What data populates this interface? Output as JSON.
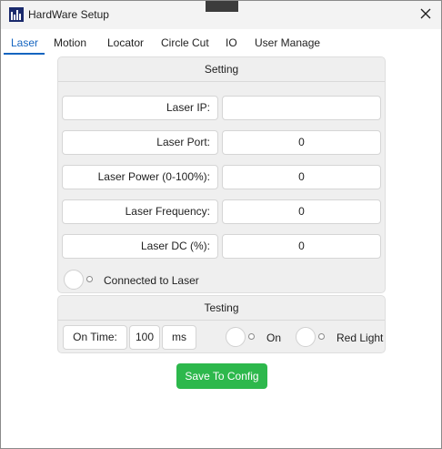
{
  "window": {
    "title": "HardWare Setup",
    "app_icon": "hardware-setup-icon",
    "close_icon": "close-icon"
  },
  "tabs": [
    {
      "label": "Laser",
      "active": true
    },
    {
      "label": "Motion",
      "active": false
    },
    {
      "label": "Locator",
      "active": false
    },
    {
      "label": "Circle Cut",
      "active": false
    },
    {
      "label": "IO",
      "active": false
    },
    {
      "label": "User Manage",
      "active": false
    }
  ],
  "setting": {
    "header": "Setting",
    "fields": [
      {
        "label": "Laser IP:",
        "value": ""
      },
      {
        "label": "Laser Port:",
        "value": "0"
      },
      {
        "label": "Laser Power (0-100%):",
        "value": "0"
      },
      {
        "label": "Laser Frequency:",
        "value": "0"
      },
      {
        "label": "Laser DC (%):",
        "value": "0"
      }
    ],
    "connected_toggle": {
      "label": "Connected to Laser",
      "checked": false
    }
  },
  "testing": {
    "header": "Testing",
    "on_time_label": "On Time:",
    "on_time_value": "100",
    "on_time_unit": "ms",
    "on_toggle": {
      "label": "On",
      "checked": false
    },
    "red_light_toggle": {
      "label": "Red Light",
      "checked": false
    }
  },
  "save_button": {
    "label": "Save To Config",
    "color": "#2db84c"
  },
  "colors": {
    "accent": "#1565c0",
    "panel": "#efefef"
  }
}
